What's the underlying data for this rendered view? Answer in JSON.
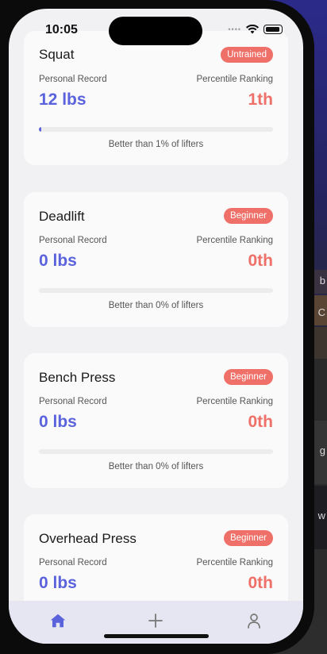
{
  "status": {
    "time": "10:05"
  },
  "background": {
    "peek_texts": [
      "b",
      "C",
      "g",
      "w"
    ]
  },
  "cards": [
    {
      "name": "Squat",
      "badge": "Untrained",
      "pr_label": "Personal Record",
      "pr_value": "12 lbs",
      "rank_label": "Percentile Ranking",
      "rank_value": "1th",
      "progress_percent": 1,
      "better_text": "Better than 1% of lifters"
    },
    {
      "name": "Deadlift",
      "badge": "Beginner",
      "pr_label": "Personal Record",
      "pr_value": "0 lbs",
      "rank_label": "Percentile Ranking",
      "rank_value": "0th",
      "progress_percent": 0,
      "better_text": "Better than 0% of lifters"
    },
    {
      "name": "Bench Press",
      "badge": "Beginner",
      "pr_label": "Personal Record",
      "pr_value": "0 lbs",
      "rank_label": "Percentile Ranking",
      "rank_value": "0th",
      "progress_percent": 0,
      "better_text": "Better than 0% of lifters"
    },
    {
      "name": "Overhead Press",
      "badge": "Beginner",
      "pr_label": "Personal Record",
      "pr_value": "0 lbs",
      "rank_label": "Percentile Ranking",
      "rank_value": "0th",
      "progress_percent": 0,
      "better_text": ""
    }
  ],
  "tabbar": {
    "items": [
      {
        "icon": "home-icon",
        "active": true
      },
      {
        "icon": "plus-icon",
        "active": false
      },
      {
        "icon": "person-icon",
        "active": false
      }
    ]
  },
  "colors": {
    "accent_blue": "#5b63dc",
    "accent_red": "#ee7068",
    "tab_active": "#5b63dc",
    "tab_inactive": "#777777"
  }
}
